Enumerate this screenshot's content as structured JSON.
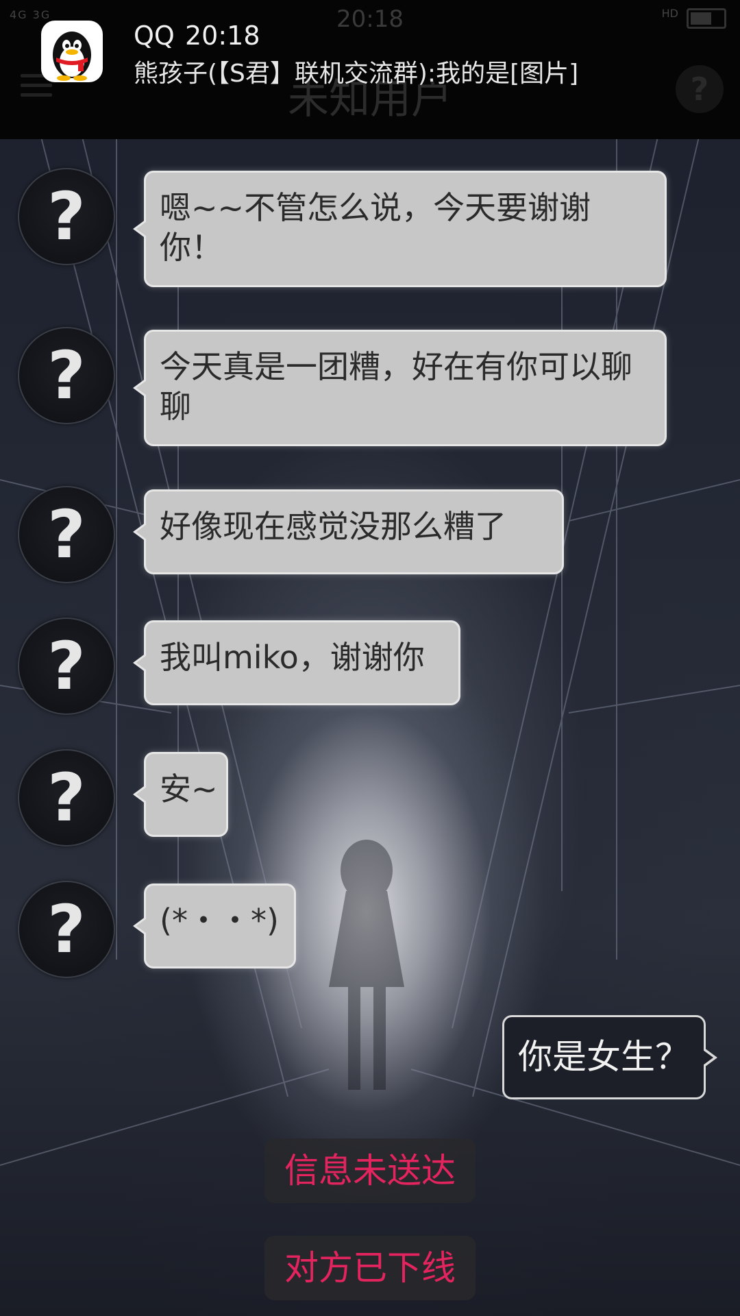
{
  "status_bar": {
    "network": "4G 3G",
    "clock": "20:18",
    "hd_label": "HD"
  },
  "header": {
    "title": "未知用户",
    "help_symbol": "?"
  },
  "notification": {
    "app_name": "QQ",
    "time": "20:18",
    "message": "熊孩子(【S君】联机交流群):我的是[图片]"
  },
  "chat": {
    "avatar_symbol": "?",
    "incoming": [
      {
        "text": "嗯~~不管怎么说，今天要谢谢你！"
      },
      {
        "text": "今天真是一团糟，好在有你可以聊聊"
      },
      {
        "text": "好像现在感觉没那么糟了"
      },
      {
        "text": "我叫miko，谢谢你"
      },
      {
        "text": "安~"
      },
      {
        "text": "(*・・*)"
      }
    ],
    "outgoing": [
      {
        "text": "你是女生？"
      }
    ]
  },
  "system_notices": [
    "信息未送达",
    "对方已下线"
  ],
  "colors": {
    "notice_text": "#e4245f",
    "incoming_bubble": "#c7c7c7",
    "outgoing_bubble": "#1c1f27"
  }
}
